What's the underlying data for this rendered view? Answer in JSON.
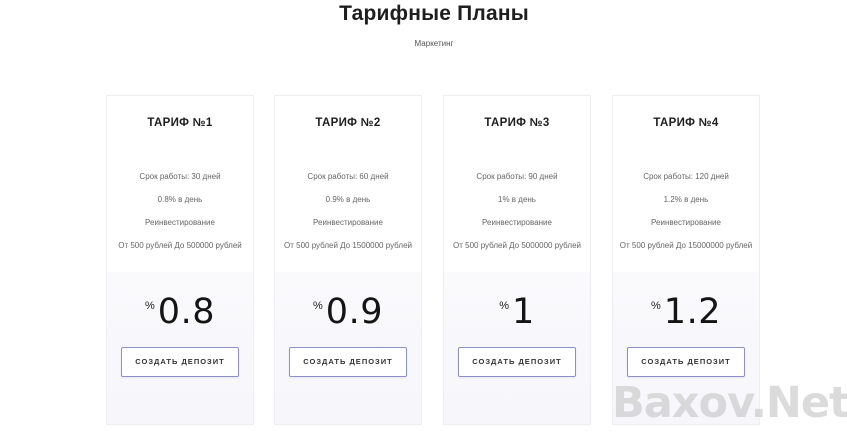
{
  "header": {
    "title": "Тарифные Планы",
    "subtitle": "Маркетинг"
  },
  "plans": [
    {
      "name": "ТАРИФ №1",
      "term": "Срок работы: 30 дней",
      "rate": "0.8% в день",
      "reinvest": "Реинвестирование",
      "range": "От 500 рублей До 500000 рублей",
      "percent_sign": "%",
      "value": "0.8",
      "button": "СОЗДАТЬ ДЕПОЗИТ"
    },
    {
      "name": "ТАРИФ №2",
      "term": "Срок работы: 60 дней",
      "rate": "0.9% в день",
      "reinvest": "Реинвестирование",
      "range": "От 500 рублей До 1500000 рублей",
      "percent_sign": "%",
      "value": "0.9",
      "button": "СОЗДАТЬ ДЕПОЗИТ"
    },
    {
      "name": "ТАРИФ №3",
      "term": "Срок работы: 90 дней",
      "rate": "1% в день",
      "reinvest": "Реинвестирование",
      "range": "От 500 рублей До 5000000 рублей",
      "percent_sign": "%",
      "value": "1",
      "button": "СОЗДАТЬ ДЕПОЗИТ"
    },
    {
      "name": "ТАРИФ №4",
      "term": "Срок работы: 120 дней",
      "rate": "1.2% в день",
      "reinvest": "Реинвестирование",
      "range": "От 500 рублей До 15000000 рублей",
      "percent_sign": "%",
      "value": "1.2",
      "button": "СОЗДАТЬ ДЕПОЗИТ"
    }
  ],
  "watermark": "Baxov.Net",
  "colors": {
    "button_border": "#8f8ec7",
    "card_border": "#ededf2",
    "card_bottom_bg": "#f8f8fc"
  }
}
